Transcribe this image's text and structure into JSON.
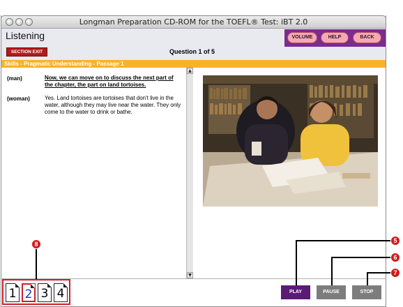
{
  "window": {
    "title": "Longman Preparation CD-ROM for the TOEFL® Test: iBT 2.0"
  },
  "header": {
    "section": "Listening",
    "nav": {
      "volume": "VOLUME",
      "help": "HELP",
      "back": "BACK"
    },
    "section_exit": "SECTION EXIT",
    "question_label": "Question 1 of 5"
  },
  "skill_bar": {
    "title": "Skills - Pragmatic Understanding - Passage 1"
  },
  "transcript": [
    {
      "speaker": "(man)",
      "text": "Now, we can move on to discuss the next part of the chapter, the part on land tortoises."
    },
    {
      "speaker": "(woman)",
      "text": "Yes. Land tortoises are tortoises that don't live in the water, although they may live near the water. They only come to the water to drink or bathe."
    }
  ],
  "media": {
    "play": "PLAY",
    "pause": "PAUSE",
    "stop": "STOP"
  },
  "pages": [
    "1",
    "2",
    "3",
    "4"
  ],
  "current_page": "2",
  "callouts": {
    "play": "5",
    "pause": "6",
    "stop": "7",
    "pages": "8"
  },
  "colors": {
    "accent_purple": "#7a2c8f",
    "skill_bar": "#f7b22a",
    "exit_red": "#b21b1b",
    "callout_red": "#d11a1a"
  }
}
